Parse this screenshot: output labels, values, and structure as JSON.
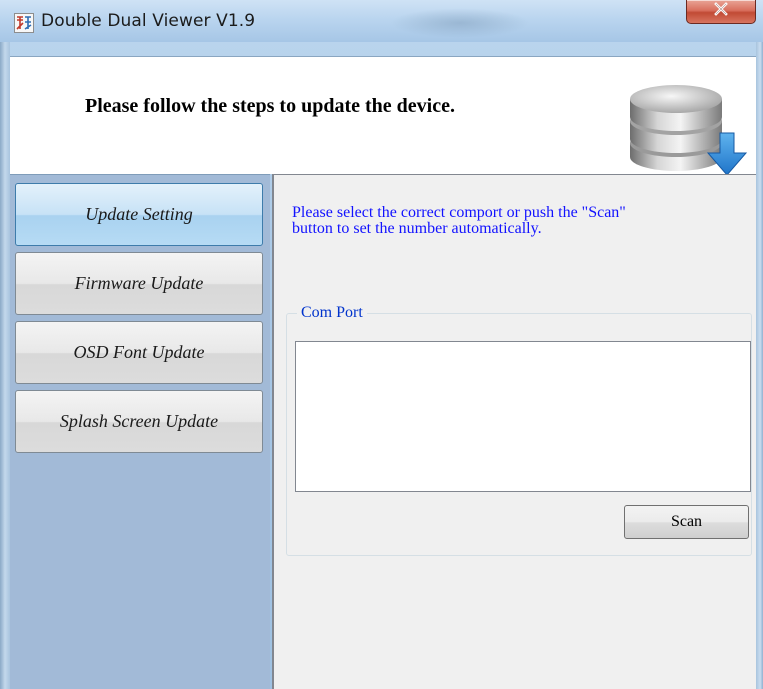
{
  "window": {
    "title": "Double Dual Viewer V1.9",
    "close_glyph": "X",
    "app_icon": "app-logo-icon"
  },
  "header": {
    "message": "Please follow the steps to update the device.",
    "icon": "database-download-icon"
  },
  "nav": {
    "items": [
      {
        "label": "Update Setting",
        "active": true
      },
      {
        "label": "Firmware Update",
        "active": false
      },
      {
        "label": "OSD Font Update",
        "active": false
      },
      {
        "label": "Splash Screen Update",
        "active": false
      }
    ]
  },
  "content": {
    "instruction_line1": "Please select the correct comport or push the \"Scan\"",
    "instruction_line2": "button to set the number automatically.",
    "group_label": "Com Port",
    "scan_label": "Scan"
  },
  "colors": {
    "accent_text": "#1212ff",
    "nav_background": "#a2bad7",
    "active_tab": "#a9d2f0",
    "close_button": "#c14a35"
  }
}
